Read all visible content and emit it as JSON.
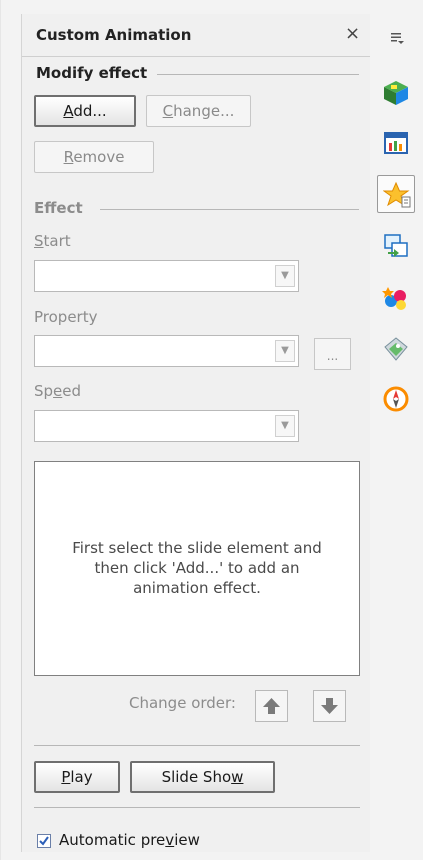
{
  "panel": {
    "title": "Custom Animation",
    "close_glyph": "×"
  },
  "modify_effect": {
    "title": "Modify effect",
    "add": {
      "prefix": "",
      "mnemonic": "A",
      "suffix": "dd..."
    },
    "change": {
      "prefix": "",
      "mnemonic": "C",
      "suffix": "hange..."
    },
    "remove": {
      "prefix": "",
      "mnemonic": "R",
      "suffix": "emove"
    }
  },
  "effect": {
    "title": "Effect",
    "start_label": {
      "prefix": "",
      "mnemonic": "S",
      "suffix": "tart"
    },
    "start_value": "",
    "property_label": "Property",
    "property_value": "",
    "property_more": "...",
    "speed_label": {
      "prefix": "Sp",
      "mnemonic": "e",
      "suffix": "ed"
    },
    "speed_value": ""
  },
  "effects_list": {
    "empty_message": "First select the slide element and then click 'Add...' to add an animation effect."
  },
  "change_order": {
    "label": "Change order:"
  },
  "actions": {
    "play": {
      "prefix": "",
      "mnemonic": "P",
      "suffix": "lay"
    },
    "slide_show": {
      "prefix": "Slide Sho",
      "mnemonic": "w",
      "suffix": ""
    }
  },
  "preview": {
    "label": {
      "prefix": "Automatic pre",
      "mnemonic": "v",
      "suffix": "iew"
    },
    "checked": true
  },
  "sidebar": {
    "tabs": [
      {
        "icon": "properties-cube-icon"
      },
      {
        "icon": "master-pages-icon"
      },
      {
        "icon": "custom-animation-star-icon",
        "active": true
      },
      {
        "icon": "slide-transition-icon"
      },
      {
        "icon": "styles-icon"
      },
      {
        "icon": "gallery-icon"
      },
      {
        "icon": "navigator-icon"
      }
    ]
  }
}
